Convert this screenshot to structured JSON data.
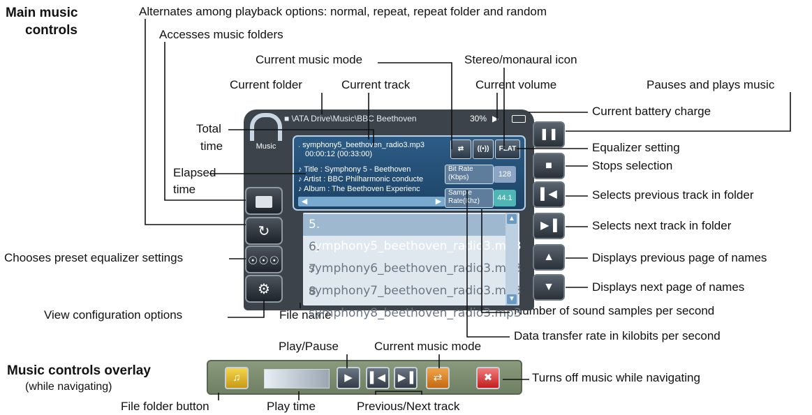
{
  "headings": {
    "main_line1": "Main music",
    "main_line2": "controls",
    "overlay_title": "Music controls overlay",
    "overlay_sub": "(while navigating)"
  },
  "labels": {
    "alternates": "Alternates among playback options: normal, repeat, repeat folder and random",
    "accesses_folders": "Accesses music folders",
    "current_mode": "Current music mode",
    "stereo_icon": "Stereo/monaural icon",
    "current_folder": "Current folder",
    "current_track": "Current track",
    "current_volume": "Current volume",
    "pauses_plays": "Pauses and plays music",
    "battery": "Current battery charge",
    "total_time_1": "Total",
    "total_time_2": "time",
    "equalizer_setting": "Equalizer setting",
    "stops": "Stops selection",
    "elapsed_1": "Elapsed",
    "elapsed_2": "time",
    "prev_track": "Selects previous track in folder",
    "next_track": "Selects next track in folder",
    "preset_eq": "Chooses preset equalizer settings",
    "prev_page": "Displays previous page of names",
    "next_page": "Displays next page of names",
    "config": "View configuration options",
    "file_name": "File name",
    "samples": "Number of sound samples per second",
    "transfer": "Data transfer rate in kilobits per second",
    "ov_play_pause": "Play/Pause",
    "ov_mode": "Current music mode",
    "ov_turns_off": "Turns off music while navigating",
    "ov_folder": "File folder button",
    "ov_play_time": "Play time",
    "ov_prev_next": "Previous/Next track"
  },
  "screen": {
    "path": "\\ATA Drive\\Music\\BBC Beethoven",
    "volume": "30%",
    "logo_text": "Music",
    "track_file": ". symphony5_beethoven_radio3.mp3",
    "time": "00:00:12   (00:33:00)",
    "title": "Title : Symphony 5 - Beethoven",
    "artist": "Artist : BBC Philharmonic conducte",
    "album": "Album : The Beethoven Experienc",
    "eq": "FLAT",
    "bitrate_label_1": "Bit Rate",
    "bitrate_label_2": "(Kbps)",
    "bitrate": "128",
    "sample_label_1": "Sample",
    "sample_label_2": "Rate(Khz)",
    "sample": "44.1",
    "tracks": [
      "5. symphony5_beethoven_radio3.mp3",
      "6. symphony6_beethoven_radio3.mp3",
      "7. symphony7_beethoven_radio3.mp3",
      "8. symphony8_beethoven_radio3.mp3"
    ]
  }
}
